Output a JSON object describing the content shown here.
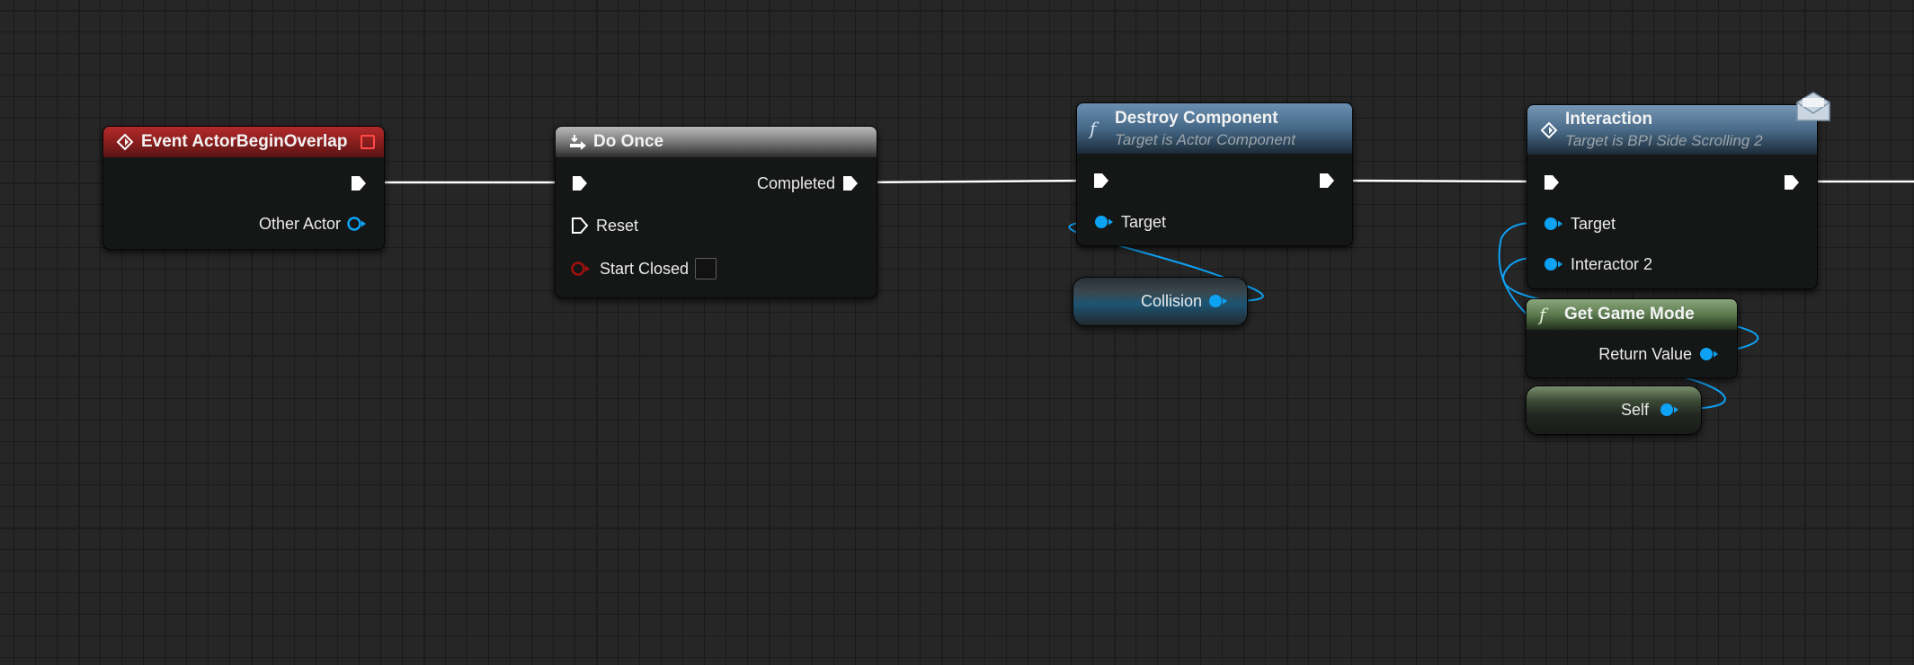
{
  "graph": {
    "event_node": {
      "title": "Event ActorBeginOverlap",
      "pins": {
        "other_actor": "Other Actor"
      }
    },
    "do_once_node": {
      "title": "Do Once",
      "pins": {
        "completed": "Completed",
        "reset": "Reset",
        "start_closed": "Start Closed"
      }
    },
    "destroy_node": {
      "title": "Destroy Component",
      "subtitle": "Target is Actor Component",
      "pins": {
        "target": "Target"
      }
    },
    "collision_node": {
      "label": "Collision"
    },
    "interaction_node": {
      "title": "Interaction",
      "subtitle": "Target is BPI Side Scrolling 2",
      "pins": {
        "target": "Target",
        "interactor": "Interactor 2"
      }
    },
    "game_mode_node": {
      "title": "Get Game Mode",
      "pins": {
        "return_value": "Return Value"
      }
    },
    "self_node": {
      "label": "Self"
    }
  },
  "icons": {
    "event": "event-diamond-icon",
    "do_once": "macro-arrow-icon",
    "function": "function-f-icon",
    "message": "interface-message-icon",
    "delegate": "delegate-square-icon"
  },
  "colors": {
    "canvas": "#262626",
    "event_header": "#8e1f1f",
    "macro_header": "#8a8a8a",
    "function_header": "#4a6b88",
    "pure_function_header": "#5c7a4e",
    "object_pin": "#0ea2f5",
    "exec_wire": "#ffffff"
  }
}
